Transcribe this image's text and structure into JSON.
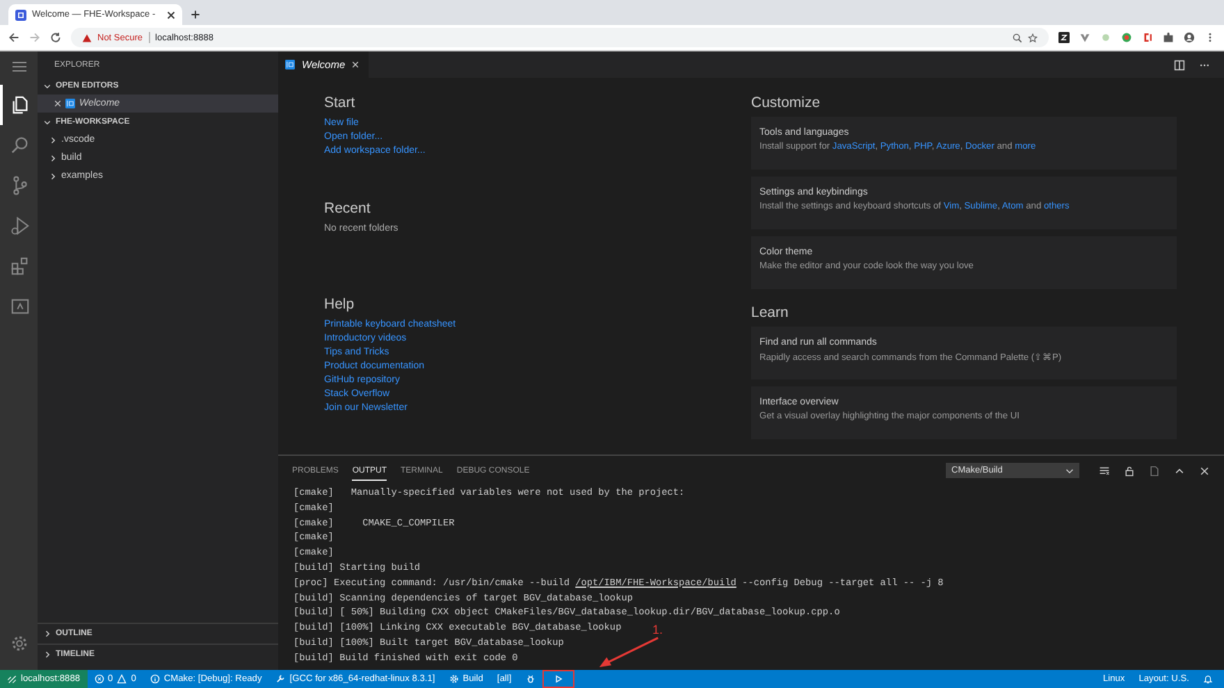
{
  "browser": {
    "tab_title": "Welcome — FHE-Workspace -",
    "security": "Not Secure",
    "url": "localhost:8888"
  },
  "activity_bar": [
    {
      "kind": "files",
      "selected": true
    },
    {
      "kind": "search",
      "selected": false
    },
    {
      "kind": "scm",
      "selected": false
    },
    {
      "kind": "run",
      "selected": false
    },
    {
      "kind": "extensions",
      "selected": false
    },
    {
      "kind": "remote",
      "selected": false
    }
  ],
  "sidebar": {
    "title": "EXPLORER",
    "open_editors": {
      "label": "OPEN EDITORS",
      "expanded": true,
      "items": [
        {
          "label": "Welcome",
          "selected": true
        }
      ]
    },
    "workspace": {
      "label": "FHE-WORKSPACE",
      "expanded": true,
      "children": [
        {
          "label": ".vscode",
          "expanded": false
        },
        {
          "label": "build",
          "expanded": false
        },
        {
          "label": "examples",
          "expanded": false
        }
      ]
    },
    "bottom_sections": [
      {
        "label": "OUTLINE",
        "expanded": false
      },
      {
        "label": "TIMELINE",
        "expanded": false
      }
    ]
  },
  "editor_tabs": [
    {
      "label": "Welcome",
      "selected": true
    }
  ],
  "welcome": {
    "left": [
      {
        "heading": "Start",
        "links": [
          "New file",
          "Open folder...",
          "Add workspace folder..."
        ]
      },
      {
        "heading": "Recent",
        "text": "No recent folders"
      },
      {
        "heading": "Help",
        "links": [
          "Printable keyboard cheatsheet",
          "Introductory videos",
          "Tips and Tricks",
          "Product documentation",
          "GitHub repository",
          "Stack Overflow",
          "Join our Newsletter"
        ]
      }
    ],
    "right": [
      {
        "heading": "Customize",
        "cards": [
          {
            "title": "Tools and languages",
            "description": [
              {
                "text": "Install support for ",
                "link": false
              },
              {
                "text": "JavaScript",
                "link": true
              },
              {
                "text": ", ",
                "link": false
              },
              {
                "text": "Python",
                "link": true
              },
              {
                "text": ", ",
                "link": false
              },
              {
                "text": "PHP",
                "link": true
              },
              {
                "text": ", ",
                "link": false
              },
              {
                "text": "Azure",
                "link": true
              },
              {
                "text": ", ",
                "link": false
              },
              {
                "text": "Docker",
                "link": true
              },
              {
                "text": " and ",
                "link": false
              },
              {
                "text": "more",
                "link": true
              }
            ]
          },
          {
            "title": "Settings and keybindings",
            "description": [
              {
                "text": "Install the settings and keyboard shortcuts of ",
                "link": false
              },
              {
                "text": "Vim",
                "link": true
              },
              {
                "text": ", ",
                "link": false
              },
              {
                "text": "Sublime",
                "link": true
              },
              {
                "text": ", ",
                "link": false
              },
              {
                "text": "Atom",
                "link": true
              },
              {
                "text": " and ",
                "link": false
              },
              {
                "text": "others",
                "link": true
              }
            ]
          },
          {
            "title": "Color theme",
            "description": [
              {
                "text": "Make the editor and your code look the way you love",
                "link": false
              }
            ]
          }
        ]
      },
      {
        "heading": "Learn",
        "cards": [
          {
            "title": "Find and run all commands",
            "description": [
              {
                "text": "Rapidly access and search commands from the Command Palette (⇧⌘P)",
                "link": false
              }
            ]
          },
          {
            "title": "Interface overview",
            "description": [
              {
                "text": "Get a visual overlay highlighting the major components of the UI",
                "link": false
              }
            ]
          }
        ]
      }
    ]
  },
  "panel": {
    "tabs": [
      {
        "label": "PROBLEMS",
        "selected": false
      },
      {
        "label": "OUTPUT",
        "selected": true
      },
      {
        "label": "TERMINAL",
        "selected": false
      },
      {
        "label": "DEBUG CONSOLE",
        "selected": false
      }
    ],
    "channel": "CMake/Build",
    "lines": [
      [
        {
          "text": "[cmake]   Manually-specified variables were not used by the project:",
          "underline": false
        }
      ],
      [
        {
          "text": "[cmake]",
          "underline": false
        }
      ],
      [
        {
          "text": "[cmake]     CMAKE_C_COMPILER",
          "underline": false
        }
      ],
      [
        {
          "text": "[cmake]",
          "underline": false
        }
      ],
      [
        {
          "text": "[cmake]",
          "underline": false
        }
      ],
      [
        {
          "text": "[build] Starting build",
          "underline": false
        }
      ],
      [
        {
          "text": "[proc] Executing command: /usr/bin/cmake --build ",
          "underline": false
        },
        {
          "text": "/opt/IBM/FHE-Workspace/build",
          "underline": true
        },
        {
          "text": " --config Debug --target all -- -j 8",
          "underline": false
        }
      ],
      [
        {
          "text": "[build] Scanning dependencies of target BGV_database_lookup",
          "underline": false
        }
      ],
      [
        {
          "text": "[build] [ 50%] Building CXX object CMakeFiles/BGV_database_lookup.dir/BGV_database_lookup.cpp.o",
          "underline": false
        }
      ],
      [
        {
          "text": "[build] [100%] Linking CXX executable BGV_database_lookup",
          "underline": false
        }
      ],
      [
        {
          "text": "[build] [100%] Built target BGV_database_lookup",
          "underline": false
        }
      ],
      [
        {
          "text": "[build] Build finished with exit code 0",
          "underline": false
        }
      ]
    ]
  },
  "status_bar": {
    "left": [
      {
        "kind": "remote",
        "text": "localhost:8888",
        "highlighted": false
      },
      {
        "kind": "problems",
        "errors": "0",
        "warnings": "0",
        "highlighted": false
      },
      {
        "kind": "status",
        "text": "CMake: [Debug]: Ready",
        "highlighted": false
      },
      {
        "kind": "kit",
        "text": "[GCC for x86_64-redhat-linux 8.3.1]",
        "highlighted": false
      },
      {
        "kind": "build",
        "text": "Build",
        "highlighted": false
      },
      {
        "kind": "text",
        "text": "[all]",
        "highlighted": false
      },
      {
        "kind": "debug",
        "highlighted": false
      },
      {
        "kind": "launch",
        "highlighted": true
      }
    ],
    "right": [
      {
        "kind": "text",
        "text": "Linux"
      },
      {
        "kind": "text",
        "text": "Layout: U.S."
      },
      {
        "kind": "bell"
      }
    ]
  },
  "annotation": {
    "label": "1."
  }
}
